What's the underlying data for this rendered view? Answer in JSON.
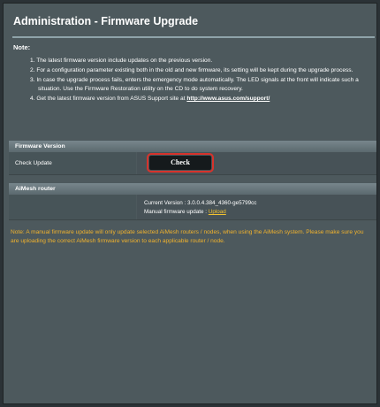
{
  "header": {
    "title": "Administration - Firmware Upgrade"
  },
  "notes": {
    "label": "Note:",
    "items": [
      "1. The latest firmware version include updates on the previous version.",
      "2. For a configuration parameter existing both in the old and new firmware, its setting will be kept during the upgrade process.",
      "3. In case the upgrade process fails, enters the emergency mode automatically. The LED signals at the front will indicate such a situation. Use the Firmware Restoration utility on the CD to do system recovery.",
      "4. Get the latest firmware version from ASUS Support site at "
    ],
    "support_link": "http://www.asus.com/support/"
  },
  "firmware_version": {
    "section_title": "Firmware Version",
    "check_label": "Check Update",
    "check_button": "Check"
  },
  "aimesh": {
    "section_title": "AiMesh router",
    "current_version": "Current Version : 3.0.0.4.384_4360-ge5799cc",
    "manual_update_label": "Manual firmware update : ",
    "upload_link": "Upload"
  },
  "warning": "Note: A manual firmware update will only update selected AiMesh routers / nodes, when using the AiMesh system. Please make sure you are uploading the correct AiMesh firmware version to each applicable router / node.",
  "colors": {
    "panel_bg": "#4d595d",
    "highlight_border": "#d6332c",
    "warning_text": "#f0b22d",
    "link_upload": "#f2c230"
  }
}
